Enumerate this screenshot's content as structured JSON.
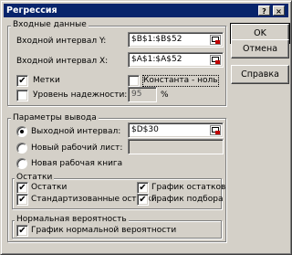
{
  "window": {
    "title": "Регрессия"
  },
  "titlebar_buttons": {
    "help": "?",
    "close": "×"
  },
  "input_group": {
    "title": "Входные данные",
    "y_label": "Входной интервал Y:",
    "y_value": "$B$1:$B$52",
    "x_label": "Входной интервал X:",
    "x_value": "$A$1:$A$52",
    "labels_checkbox": {
      "label": "Метки",
      "checked": "✔"
    },
    "constant_zero_checkbox": {
      "label": "Константа - ноль",
      "checked": ""
    },
    "confidence_checkbox": {
      "label": "Уровень надежности:",
      "checked": ""
    },
    "confidence_value": "95",
    "confidence_unit": "%"
  },
  "output_group": {
    "title": "Параметры вывода",
    "output_range_label": "Выходной интервал:",
    "output_range_value": "$D$30",
    "new_sheet_label": "Новый рабочий лист:",
    "new_sheet_value": "",
    "new_workbook_label": "Новая рабочая книга"
  },
  "residuals_group": {
    "title": "Остатки",
    "residuals": {
      "label": "Остатки",
      "checked": "✔"
    },
    "standardized": {
      "label": "Стандартизованные остатки",
      "checked": "✔"
    },
    "residual_plot": {
      "label": "График остатков",
      "checked": "✔"
    },
    "fit_plot": {
      "label": "График подбора",
      "checked": "✔"
    }
  },
  "normal_group": {
    "title": "Нормальная вероятность",
    "normal_plot": {
      "label": "График нормальной вероятности",
      "checked": "✔"
    }
  },
  "buttons": {
    "ok": "OK",
    "cancel": "Отмена",
    "help": "Справка"
  }
}
